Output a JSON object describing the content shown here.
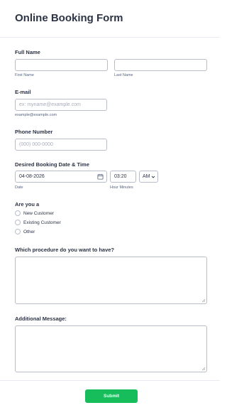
{
  "form": {
    "title": "Online Booking Form",
    "full_name": {
      "label": "Full Name",
      "first_sublabel": "First Name",
      "last_sublabel": "Last Name",
      "first_value": "",
      "last_value": ""
    },
    "email": {
      "label": "E-mail",
      "placeholder": "ex: myname@example.com",
      "sublabel": "example@example.com"
    },
    "phone": {
      "label": "Phone Number",
      "placeholder": "(000) 000-0000"
    },
    "booking": {
      "label": "Desired Booking Date & Time",
      "date_value": "04-08-2026",
      "date_sublabel": "Date",
      "time_value": "03:20",
      "time_sublabel": "Hour Minutes",
      "ampm_value": "AM"
    },
    "are_you": {
      "label": "Are you a",
      "options": [
        "New Customer",
        "Existing Customer",
        "Other"
      ]
    },
    "procedure": {
      "label": "Which procedure do you want to have?"
    },
    "message": {
      "label": "Additional Message:"
    },
    "submit_label": "Submit"
  },
  "colors": {
    "accent": "#18bd5b",
    "text": "#2c3345",
    "border": "#b8bdc9"
  },
  "icons": {
    "date": "calendar-icon",
    "ampm": "chevron-down-icon"
  }
}
